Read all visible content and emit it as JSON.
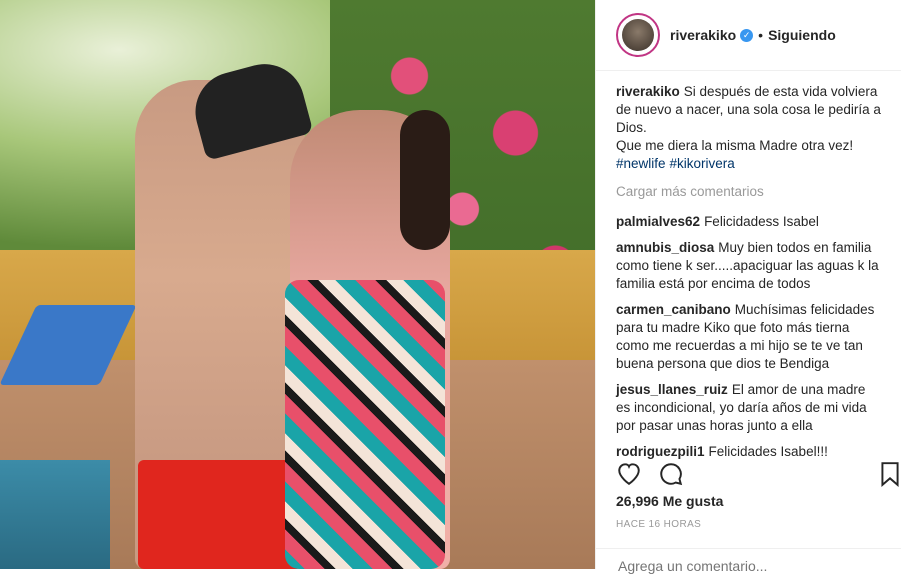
{
  "post": {
    "username": "riverakiko",
    "follow_status": "Siguiendo",
    "separator": "•",
    "verified_mark": "✓",
    "caption": {
      "username": "riverakiko",
      "line1": "Si después de esta vida volviera de nuevo a nacer, una sola cosa le pediría a Dios.",
      "line2": "Que me diera la misma Madre otra vez!",
      "hashtag1": "#newlife",
      "hashtag2": "#kikorivera"
    },
    "load_more": "Cargar más comentarios",
    "comments": [
      {
        "user": "palmialves62",
        "text": "Felicidadess Isabel"
      },
      {
        "user": "amnubis_diosa",
        "text": "Muy bien todos en familia como tiene k ser.....apaciguar las aguas k la familia está por encima de todos"
      },
      {
        "user": "carmen_canibano",
        "text": "Muchísimas felicidades para tu madre Kiko que foto más tierna como me recuerdas a mi hijo se te ve tan buena persona que dios te Bendiga"
      },
      {
        "user": "jesus_llanes_ruiz",
        "text": "El amor de una madre es incondicional, yo daría años de mi vida por pasar unas horas junto a ella"
      },
      {
        "user": "rodriguezpili1",
        "text": "Felicidades Isabel!!!"
      }
    ],
    "likes": "26,996 Me gusta",
    "timestamp": "HACE 16 HORAS",
    "comment_placeholder": "Agrega un comentario..."
  },
  "colors": {
    "link": "#003569",
    "muted": "#999999",
    "verified": "#3897f0"
  },
  "icons": [
    "heart-icon",
    "comment-icon",
    "bookmark-icon",
    "verified-icon"
  ]
}
